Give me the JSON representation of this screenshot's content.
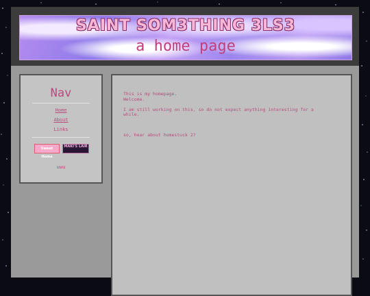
{
  "header": {
    "site_title": "SAINT SOM3THING 3LS3",
    "subtitle": "a home page"
  },
  "nav": {
    "title": "Nav",
    "links": [
      "Home",
      "About",
      "Links"
    ],
    "badges": [
      "Sweet Home",
      "MAKI'S LAIR"
    ],
    "footer_text": "uwu"
  },
  "main": {
    "lines": [
      "This is my homepage.",
      "Welcome.",
      "I am still working on this, so do not expect anything interesting for a",
      "while.",
      "so, hear about homestuck 2?"
    ]
  },
  "colors": {
    "background": "#0b0b14",
    "page": "#9a9a9a",
    "panel": "#c0c0c0",
    "accent": "#b84a7c"
  }
}
